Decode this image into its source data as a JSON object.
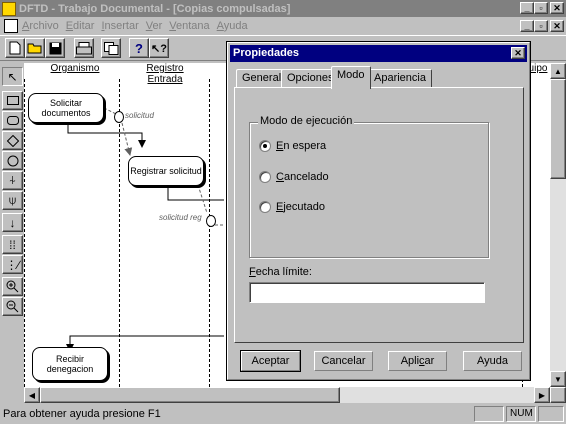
{
  "window": {
    "title": "DFTD - Trabajo Documental - [Copias compulsadas]"
  },
  "menubar": {
    "items": [
      {
        "accel": "A",
        "rest": "rchivo"
      },
      {
        "accel": "E",
        "rest": "ditar"
      },
      {
        "accel": "I",
        "rest": "nsertar"
      },
      {
        "accel": "V",
        "rest": "er"
      },
      {
        "accel": "V",
        "rest": "entana"
      },
      {
        "accel": "A",
        "rest": "yuda"
      }
    ]
  },
  "toolbar": {
    "buttons": [
      "new-document-icon",
      "open-folder-icon",
      "save-disk-icon",
      "print-icon",
      "copy-icon",
      "help-icon",
      "context-help-icon"
    ]
  },
  "palette": {
    "tools": [
      "select-arrow-icon",
      "rectangle-icon",
      "rounded-rect-icon",
      "diamond-icon",
      "circle-icon",
      "split-icon",
      "merge-icon",
      "down-arrow-icon",
      "parallel-icon",
      "branch-icon",
      "zoom-in-icon",
      "zoom-out-icon"
    ]
  },
  "diagram": {
    "lanes": [
      "Organismo",
      "Registro Entrada",
      "uipo"
    ],
    "tasks": {
      "solicitar": "Solicitar documentos",
      "registrar": "Registrar solicitud",
      "recibir": "Recibir denegacion"
    },
    "objects": {
      "solicitud": "solicitud",
      "solicitud_reg": "solicitud reg"
    }
  },
  "dialog": {
    "title": "Propiedades",
    "tabs": [
      "General",
      "Opciones",
      "Modo",
      "Apariencia"
    ],
    "active_tab": "Modo",
    "group_title": "Modo de ejecución",
    "radios": [
      {
        "accel": "E",
        "rest": "n espera",
        "selected": true
      },
      {
        "accel": "C",
        "rest": "ancelado",
        "selected": false
      },
      {
        "accel": "E",
        "rest": "jecutado",
        "selected": false
      }
    ],
    "date_label_accel": "F",
    "date_label_rest": "echa límite:",
    "date_value": "",
    "buttons": {
      "accept": "Aceptar",
      "cancel": "Cancelar",
      "apply_pre": "Apli",
      "apply_accel": "c",
      "apply_post": "ar",
      "help": "Ayuda"
    }
  },
  "statusbar": {
    "message": "Para obtener ayuda presione F1",
    "num": "NUM"
  }
}
